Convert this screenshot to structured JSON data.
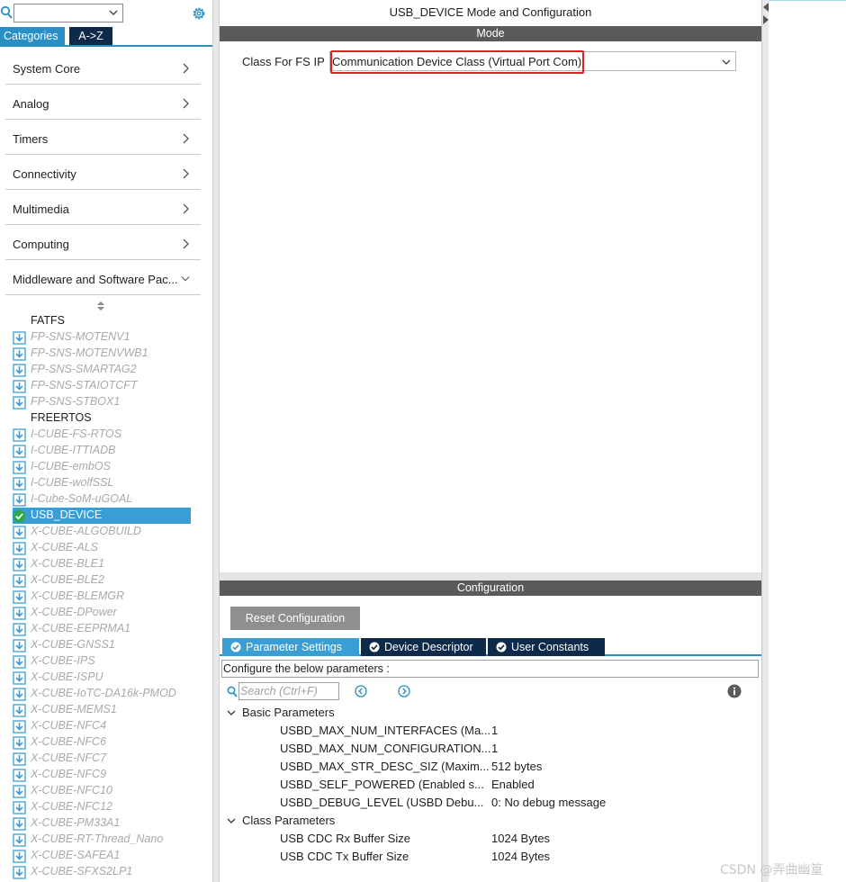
{
  "left_panel": {
    "search": {
      "value": ""
    },
    "tabs": {
      "categories": "Categories",
      "az": "A->Z"
    },
    "categories": [
      {
        "label": "System Core"
      },
      {
        "label": "Analog"
      },
      {
        "label": "Timers"
      },
      {
        "label": "Connectivity"
      },
      {
        "label": "Multimedia"
      },
      {
        "label": "Computing"
      },
      {
        "label": "Middleware and Software Pac..."
      }
    ],
    "tree": {
      "group_fatfs": "FATFS",
      "group_freertos": "FREERTOS",
      "packs_fatfs": [
        "FP-SNS-MOTENV1",
        "FP-SNS-MOTENVWB1",
        "FP-SNS-SMARTAG2",
        "FP-SNS-STAIOTCFT",
        "FP-SNS-STBOX1"
      ],
      "packs_rtos": [
        "I-CUBE-FS-RTOS",
        "I-CUBE-ITTIADB",
        "I-CUBE-embOS",
        "I-CUBE-wolfSSL",
        "I-Cube-SoM-uGOAL"
      ],
      "selected": "USB_DEVICE",
      "packs_x": [
        "X-CUBE-ALGOBUILD",
        "X-CUBE-ALS",
        "X-CUBE-BLE1",
        "X-CUBE-BLE2",
        "X-CUBE-BLEMGR",
        "X-CUBE-DPower",
        "X-CUBE-EEPRMA1",
        "X-CUBE-GNSS1",
        "X-CUBE-IPS",
        "X-CUBE-ISPU",
        "X-CUBE-IoTC-DA16k-PMOD",
        "X-CUBE-MEMS1",
        "X-CUBE-NFC4",
        "X-CUBE-NFC6",
        "X-CUBE-NFC7",
        "X-CUBE-NFC9",
        "X-CUBE-NFC10",
        "X-CUBE-NFC12",
        "X-CUBE-PM33A1",
        "X-CUBE-RT-Thread_Nano",
        "X-CUBE-SAFEA1",
        "X-CUBE-SFXS2LP1"
      ]
    }
  },
  "right_panel": {
    "title": "USB_DEVICE Mode and Configuration",
    "mode_header": "Mode",
    "class_label": "Class For FS IP",
    "class_value": "Communication Device Class (Virtual Port Com)",
    "config_header": "Configuration",
    "reset_button": "Reset Configuration",
    "tabs": [
      "Parameter Settings",
      "Device Descriptor",
      "User Constants"
    ],
    "hint": "Configure the below parameters :",
    "search_placeholder": "Search (Ctrl+F)",
    "groups": [
      {
        "name": "Basic Parameters",
        "params": [
          {
            "name": "USBD_MAX_NUM_INTERFACES (Ma...",
            "value": "1"
          },
          {
            "name": "USBD_MAX_NUM_CONFIGURATION...",
            "value": "1"
          },
          {
            "name": "USBD_MAX_STR_DESC_SIZ (Maxim...",
            "value": "512 bytes"
          },
          {
            "name": "USBD_SELF_POWERED (Enabled s...",
            "value": "Enabled"
          },
          {
            "name": "USBD_DEBUG_LEVEL (USBD Debu...",
            "value": "0: No debug message"
          }
        ]
      },
      {
        "name": "Class Parameters",
        "params": [
          {
            "name": "USB CDC Rx Buffer Size",
            "value": "1024 Bytes"
          },
          {
            "name": "USB CDC Tx Buffer Size",
            "value": "1024 Bytes"
          }
        ]
      }
    ]
  },
  "watermark": "CSDN @弄曲幽篁",
  "colors": {
    "accent": "#2a8fc4",
    "dark_tab": "#0d2a4a",
    "selected": "#3a9ed6",
    "header_bar": "#5a5a5a",
    "highlight": "#e02020"
  },
  "icons": [
    "search-icon",
    "gear-icon",
    "chevron-right-icon",
    "chevron-down-icon",
    "download-icon",
    "check-circle-icon",
    "info-icon",
    "nav-prev-icon",
    "nav-next-icon"
  ]
}
